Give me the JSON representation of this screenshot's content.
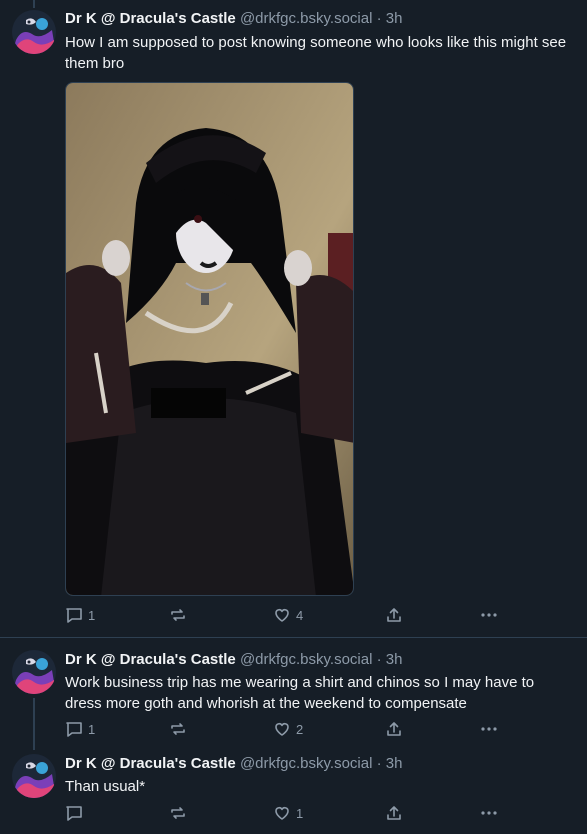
{
  "posts": [
    {
      "author_name": "Dr K @ Dracula's Castle",
      "handle": "@drkfgc.bsky.social",
      "separator": "·",
      "time": "3h",
      "text": "How I am supposed to post knowing someone who looks like this might see them bro",
      "replies": "1",
      "reposts": "",
      "likes": "4"
    },
    {
      "author_name": "Dr K @ Dracula's Castle",
      "handle": "@drkfgc.bsky.social",
      "separator": "·",
      "time": "3h",
      "text": "Work business trip has me wearing a shirt and chinos so I may have to dress more goth and whorish at the weekend to compensate",
      "replies": "1",
      "reposts": "",
      "likes": "2"
    },
    {
      "author_name": "Dr K @ Dracula's Castle",
      "handle": "@drkfgc.bsky.social",
      "separator": "·",
      "time": "3h",
      "text": "Than usual*",
      "replies": "",
      "reposts": "",
      "likes": "1"
    }
  ],
  "colors": {
    "background": "#161e27",
    "text_primary": "#f1f3f5",
    "text_secondary": "#8d9aa8",
    "border": "#2e4052"
  },
  "icons": [
    "reply-icon",
    "repost-icon",
    "like-icon",
    "share-icon",
    "more-icon"
  ]
}
